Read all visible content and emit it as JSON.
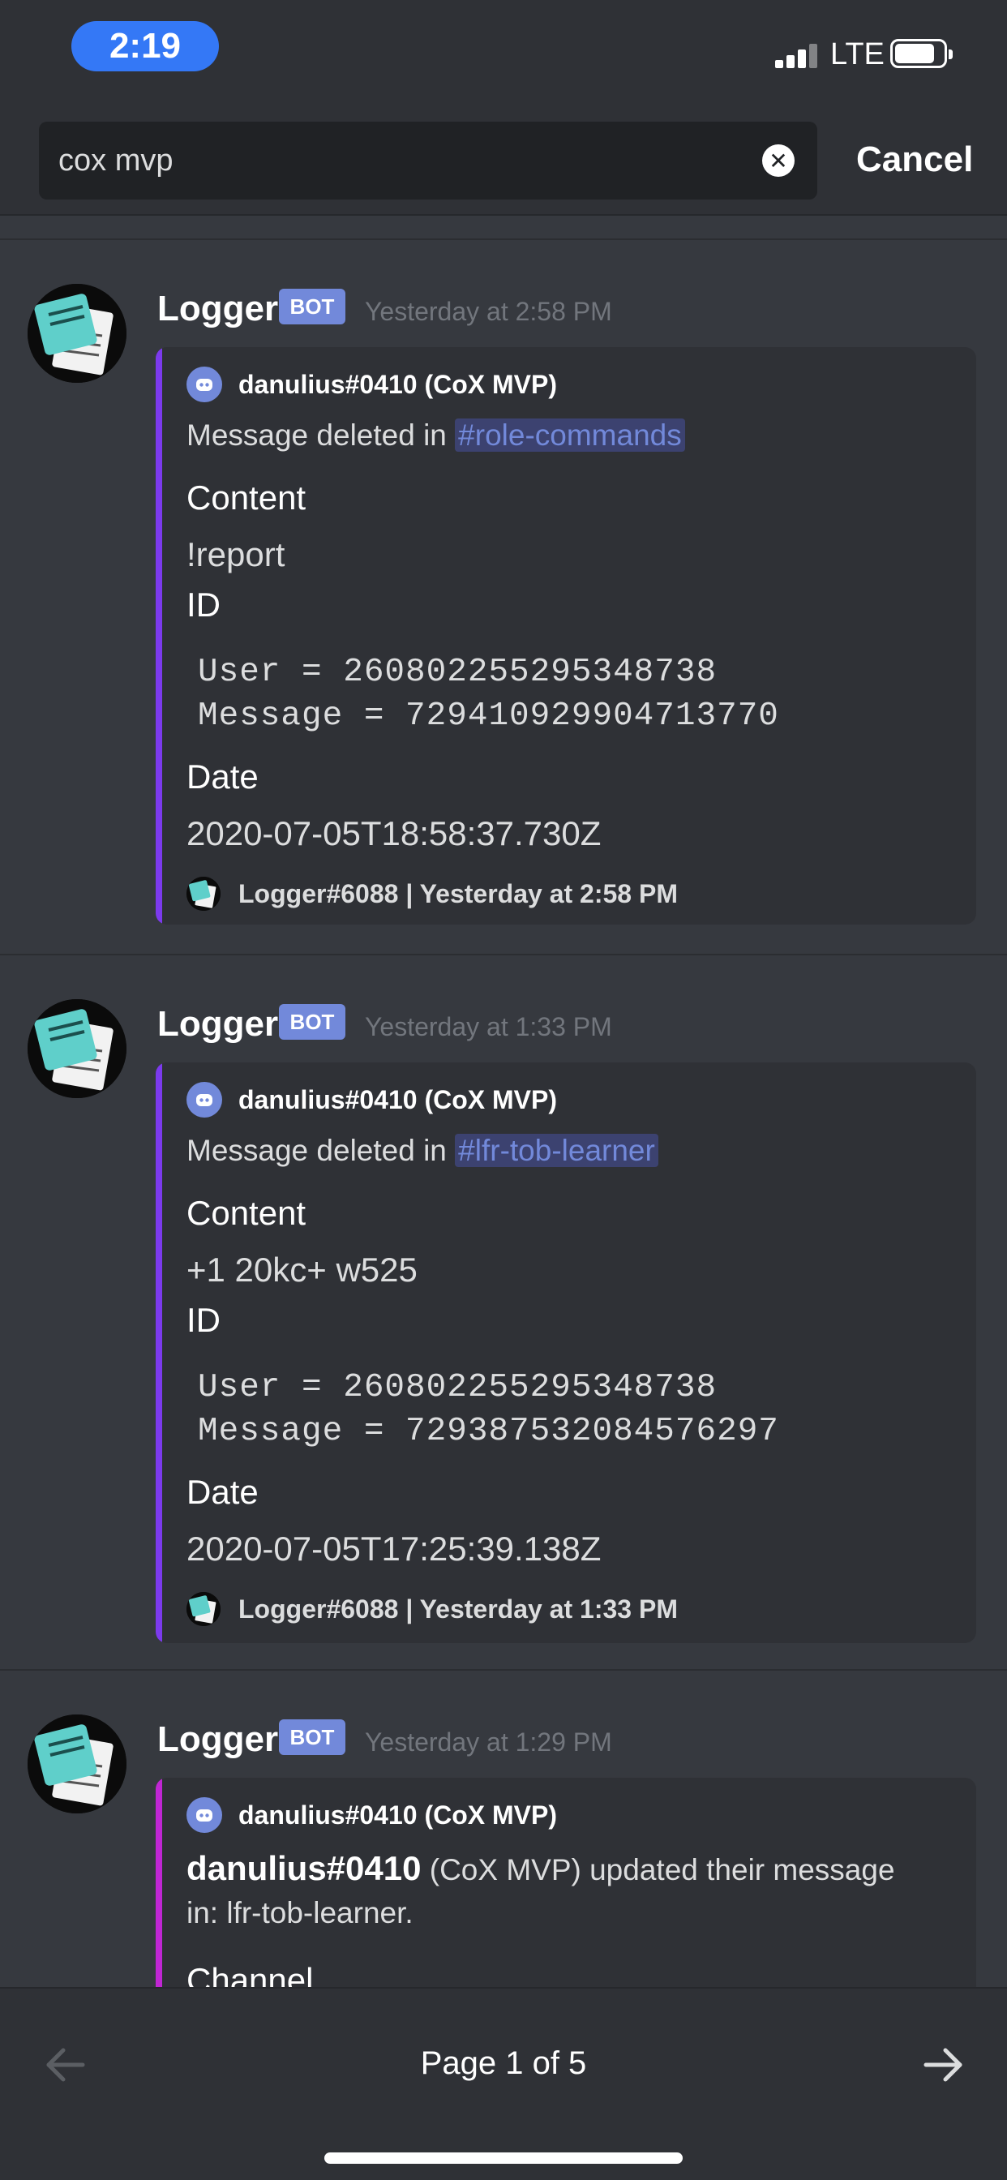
{
  "status_bar": {
    "time": "2:19",
    "network": "LTE"
  },
  "search": {
    "query": "cox mvp",
    "cancel_label": "Cancel"
  },
  "messages": [
    {
      "author": "Logger",
      "bot_tag": "BOT",
      "timestamp": "Yesterday at 2:58 PM",
      "embed": {
        "accent_color": "#7c3aed",
        "author_name": "danulius#0410 (CoX MVP)",
        "desc_prefix": "Message deleted in",
        "channel": "#role-commands",
        "content_label": "Content",
        "content_value": "!report",
        "id_label": "ID",
        "code_user": "User = 260802255295348738",
        "code_message": "Message = 729410929904713770",
        "date_label": "Date",
        "date_value": "2020-07-05T18:58:37.730Z",
        "footer": "Logger#6088 | Yesterday at 2:58 PM"
      }
    },
    {
      "author": "Logger",
      "bot_tag": "BOT",
      "timestamp": "Yesterday at 1:33 PM",
      "embed": {
        "accent_color": "#7c3aed",
        "author_name": "danulius#0410 (CoX MVP)",
        "desc_prefix": "Message deleted in",
        "channel": "#lfr-tob-learner",
        "content_label": "Content",
        "content_value": "+1 20kc+ w525",
        "id_label": "ID",
        "code_user": "User = 260802255295348738",
        "code_message": "Message = 729387532084576297",
        "date_label": "Date",
        "date_value": "2020-07-05T17:25:39.138Z",
        "footer": "Logger#6088 | Yesterday at 1:33 PM"
      }
    },
    {
      "author": "Logger",
      "bot_tag": "BOT",
      "timestamp": "Yesterday at 1:29 PM",
      "embed": {
        "accent_color": "#c026d3",
        "author_name": "danulius#0410 (CoX MVP)",
        "user_bold": "danulius#0410",
        "desc_rest": "(CoX MVP) updated their message",
        "desc_line2": "in: lfr-tob-learner.",
        "field_partial": "Channel"
      }
    }
  ],
  "pager": {
    "label": "Page 1 of 5"
  },
  "icons": {
    "avatar": "notepad-icon",
    "embed_author": "discord-logo-icon",
    "clear": "clear-circle-icon",
    "prev": "arrow-left-icon",
    "next": "arrow-right-icon"
  }
}
